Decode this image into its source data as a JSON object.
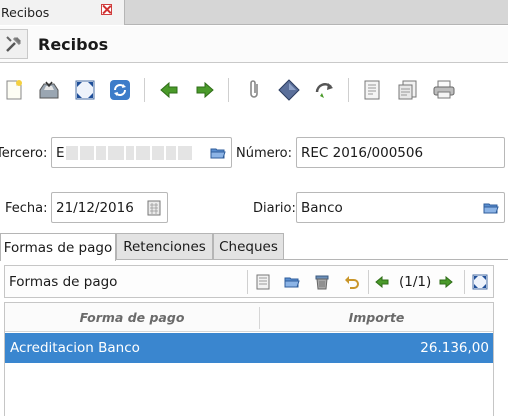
{
  "window_tab": {
    "label": "Recibos"
  },
  "header": {
    "title": "Recibos"
  },
  "toolbar": {
    "icons": [
      "new-icon",
      "save-icon",
      "fullscreen-icon",
      "reload-icon",
      "previous-icon",
      "next-icon",
      "attachment-icon",
      "action-icon",
      "relate-icon",
      "report-icon",
      "email-icon",
      "print-icon"
    ]
  },
  "form": {
    "tercero_label": "Tercero:",
    "tercero_value": "E",
    "numero_label": "Número:",
    "numero_value": "REC 2016/000506",
    "fecha_label": "Fecha:",
    "fecha_value": "21/12/2016",
    "diario_label": "Diario:",
    "diario_value": "Banco"
  },
  "tabs": [
    {
      "label": "Formas de pago",
      "active": true
    },
    {
      "label": "Retenciones",
      "active": false
    },
    {
      "label": "Cheques",
      "active": false
    }
  ],
  "lines": {
    "title": "Formas de pago",
    "count": "(1/1)",
    "columns": [
      "Forma de pago",
      "Importe"
    ],
    "rows": [
      {
        "forma": "Acreditacion Banco",
        "importe": "26.136,00",
        "selected": true
      }
    ]
  },
  "colors": {
    "selection": "#3a86cf",
    "accent_green": "#4a9a2a"
  }
}
